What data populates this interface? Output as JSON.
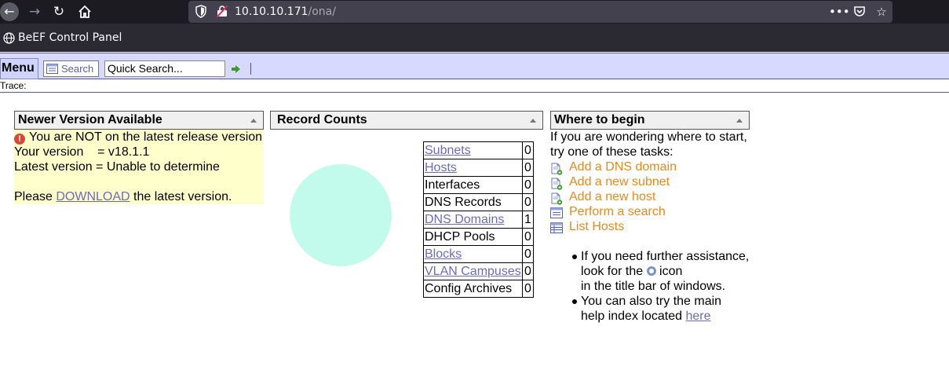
{
  "browser": {
    "url_host": "10.10.10.171",
    "url_path": "/ona/",
    "tab_title": "BeEF Control Panel"
  },
  "menubar": {
    "menu_label": "Menu",
    "search_label": "Search",
    "quick_search_value": "Quick Search..."
  },
  "trace_label": "Trace:",
  "newer_version": {
    "title": "Newer Version Available",
    "warning": "You are NOT on the latest release version",
    "your_version": "Your version    = v18.1.1",
    "latest_version": "Latest version = Unable to determine",
    "download_prefix": "Please ",
    "download_link": "DOWNLOAD",
    "download_suffix": " the latest version."
  },
  "record_counts": {
    "title": "Record Counts",
    "rows": [
      {
        "label": "Subnets",
        "count": "0",
        "link": true
      },
      {
        "label": "Hosts",
        "count": "0",
        "link": true
      },
      {
        "label": "Interfaces",
        "count": "0",
        "link": false
      },
      {
        "label": "DNS Records",
        "count": "0",
        "link": false
      },
      {
        "label": "DNS Domains",
        "count": "1",
        "link": true
      },
      {
        "label": "DHCP Pools",
        "count": "0",
        "link": false
      },
      {
        "label": "Blocks",
        "count": "0",
        "link": true
      },
      {
        "label": "VLAN Campuses",
        "count": "0",
        "link": true
      },
      {
        "label": "Config Archives",
        "count": "0",
        "link": false
      }
    ]
  },
  "where_to_begin": {
    "title": "Where to begin",
    "intro_1": "If you are wondering where to start,",
    "intro_2": "try one of these tasks:",
    "tasks": [
      {
        "label": "Add a DNS domain",
        "icon": "add-page-icon"
      },
      {
        "label": "Add a new subnet",
        "icon": "add-page-icon"
      },
      {
        "label": "Add a new host",
        "icon": "add-page-icon"
      },
      {
        "label": "Perform a search",
        "icon": "search-form-icon"
      },
      {
        "label": "List Hosts",
        "icon": "list-icon"
      }
    ],
    "help_1a": "If you need further assistance,",
    "help_1b_pre": "look for the ",
    "help_1b_post": " icon",
    "help_1c": "in the title bar of windows.",
    "help_2a": "You can also try the main",
    "help_2b_pre": "help index located ",
    "help_2b_link": "here"
  },
  "colors": {
    "menubar_bg": "#d7d9ff",
    "task_link": "#e68a1d",
    "link": "#6c6cb8",
    "notice_bg": "#ffffcc",
    "pie_fill": "#c2fbeb"
  }
}
